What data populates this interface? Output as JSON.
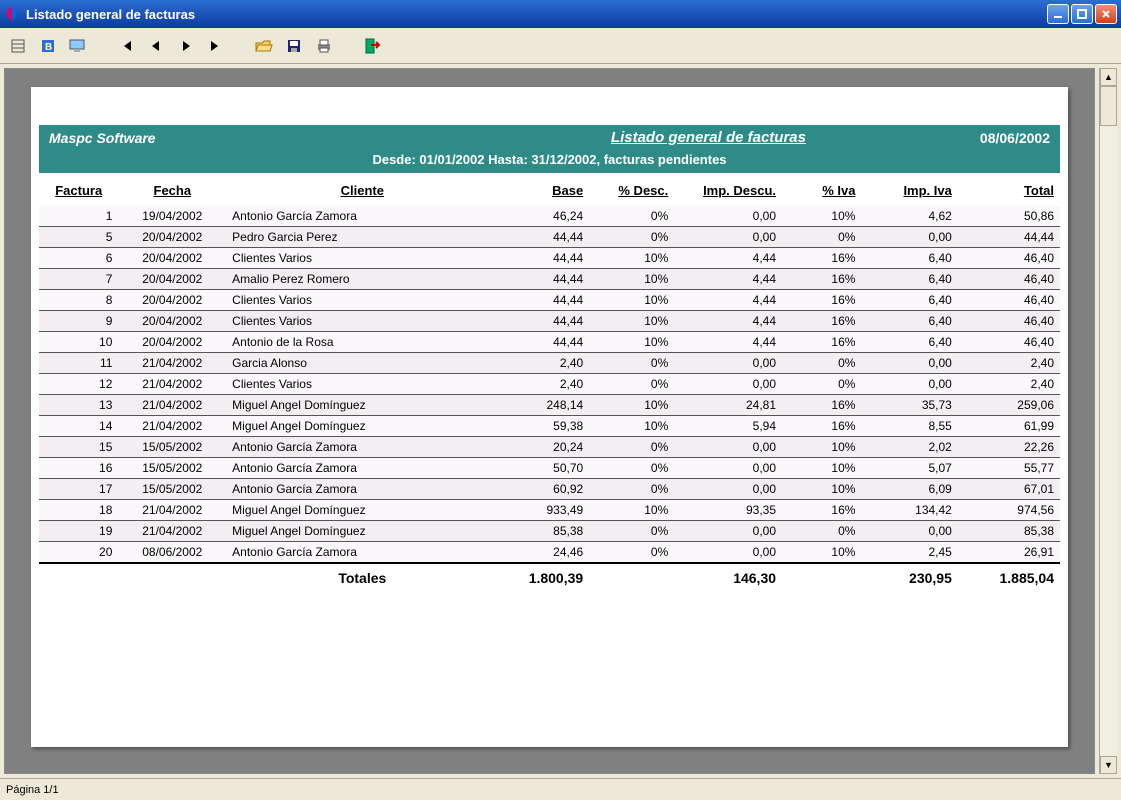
{
  "window": {
    "title": "Listado general de facturas"
  },
  "toolbar": {
    "icons": [
      "list",
      "grid",
      "display",
      "first",
      "prev",
      "next",
      "last",
      "open",
      "save",
      "print",
      "exit"
    ]
  },
  "report": {
    "brand": "Maspc Software",
    "title": "Listado general de facturas",
    "date": "08/06/2002",
    "range": "Desde: 01/01/2002 Hasta: 31/12/2002, facturas pendientes",
    "columns": {
      "factura": "Factura",
      "fecha": "Fecha",
      "cliente": "Cliente",
      "base": "Base",
      "pdesc": "% Desc.",
      "idesc": "Imp. Descu.",
      "piva": "% Iva",
      "iiva": "Imp. Iva",
      "total": "Total"
    },
    "rows": [
      {
        "factura": "1",
        "fecha": "19/04/2002",
        "cliente": "Antonio García Zamora",
        "base": "46,24",
        "pdesc": "0%",
        "idesc": "0,00",
        "piva": "10%",
        "iiva": "4,62",
        "total": "50,86"
      },
      {
        "factura": "5",
        "fecha": "20/04/2002",
        "cliente": "Pedro Garcia Perez",
        "base": "44,44",
        "pdesc": "0%",
        "idesc": "0,00",
        "piva": "0%",
        "iiva": "0,00",
        "total": "44,44"
      },
      {
        "factura": "6",
        "fecha": "20/04/2002",
        "cliente": "Clientes Varios",
        "base": "44,44",
        "pdesc": "10%",
        "idesc": "4,44",
        "piva": "16%",
        "iiva": "6,40",
        "total": "46,40"
      },
      {
        "factura": "7",
        "fecha": "20/04/2002",
        "cliente": "Amalio Perez Romero",
        "base": "44,44",
        "pdesc": "10%",
        "idesc": "4,44",
        "piva": "16%",
        "iiva": "6,40",
        "total": "46,40"
      },
      {
        "factura": "8",
        "fecha": "20/04/2002",
        "cliente": "Clientes Varios",
        "base": "44,44",
        "pdesc": "10%",
        "idesc": "4,44",
        "piva": "16%",
        "iiva": "6,40",
        "total": "46,40"
      },
      {
        "factura": "9",
        "fecha": "20/04/2002",
        "cliente": "Clientes Varios",
        "base": "44,44",
        "pdesc": "10%",
        "idesc": "4,44",
        "piva": "16%",
        "iiva": "6,40",
        "total": "46,40"
      },
      {
        "factura": "10",
        "fecha": "20/04/2002",
        "cliente": "Antonio de la Rosa",
        "base": "44,44",
        "pdesc": "10%",
        "idesc": "4,44",
        "piva": "16%",
        "iiva": "6,40",
        "total": "46,40"
      },
      {
        "factura": "11",
        "fecha": "21/04/2002",
        "cliente": "Garcia Alonso",
        "base": "2,40",
        "pdesc": "0%",
        "idesc": "0,00",
        "piva": "0%",
        "iiva": "0,00",
        "total": "2,40"
      },
      {
        "factura": "12",
        "fecha": "21/04/2002",
        "cliente": "Clientes Varios",
        "base": "2,40",
        "pdesc": "0%",
        "idesc": "0,00",
        "piva": "0%",
        "iiva": "0,00",
        "total": "2,40"
      },
      {
        "factura": "13",
        "fecha": "21/04/2002",
        "cliente": "Miguel Angel Domínguez",
        "base": "248,14",
        "pdesc": "10%",
        "idesc": "24,81",
        "piva": "16%",
        "iiva": "35,73",
        "total": "259,06"
      },
      {
        "factura": "14",
        "fecha": "21/04/2002",
        "cliente": "Miguel Angel Domínguez",
        "base": "59,38",
        "pdesc": "10%",
        "idesc": "5,94",
        "piva": "16%",
        "iiva": "8,55",
        "total": "61,99"
      },
      {
        "factura": "15",
        "fecha": "15/05/2002",
        "cliente": "Antonio García Zamora",
        "base": "20,24",
        "pdesc": "0%",
        "idesc": "0,00",
        "piva": "10%",
        "iiva": "2,02",
        "total": "22,26"
      },
      {
        "factura": "16",
        "fecha": "15/05/2002",
        "cliente": "Antonio García Zamora",
        "base": "50,70",
        "pdesc": "0%",
        "idesc": "0,00",
        "piva": "10%",
        "iiva": "5,07",
        "total": "55,77"
      },
      {
        "factura": "17",
        "fecha": "15/05/2002",
        "cliente": "Antonio García Zamora",
        "base": "60,92",
        "pdesc": "0%",
        "idesc": "0,00",
        "piva": "10%",
        "iiva": "6,09",
        "total": "67,01"
      },
      {
        "factura": "18",
        "fecha": "21/04/2002",
        "cliente": "Miguel Angel Domínguez",
        "base": "933,49",
        "pdesc": "10%",
        "idesc": "93,35",
        "piva": "16%",
        "iiva": "134,42",
        "total": "974,56"
      },
      {
        "factura": "19",
        "fecha": "21/04/2002",
        "cliente": "Miguel Angel Domínguez",
        "base": "85,38",
        "pdesc": "0%",
        "idesc": "0,00",
        "piva": "0%",
        "iiva": "0,00",
        "total": "85,38"
      },
      {
        "factura": "20",
        "fecha": "08/06/2002",
        "cliente": "Antonio García Zamora",
        "base": "24,46",
        "pdesc": "0%",
        "idesc": "0,00",
        "piva": "10%",
        "iiva": "2,45",
        "total": "26,91"
      }
    ],
    "totals": {
      "label": "Totales",
      "base": "1.800,39",
      "idesc": "146,30",
      "iiva": "230,95",
      "total": "1.885,04"
    }
  },
  "status": {
    "page": "Página 1/1"
  }
}
